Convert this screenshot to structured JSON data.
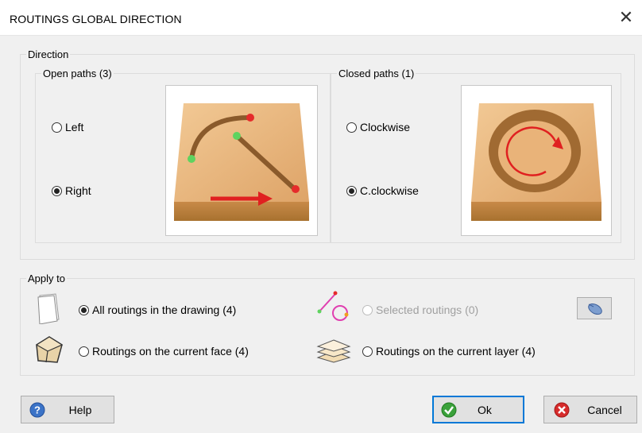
{
  "window": {
    "title": "ROUTINGS GLOBAL DIRECTION",
    "close_glyph": "✕"
  },
  "direction": {
    "legend": "Direction",
    "open_paths": {
      "legend": "Open paths (3)",
      "options": [
        {
          "label": "Left",
          "selected": false
        },
        {
          "label": "Right",
          "selected": true
        }
      ]
    },
    "closed_paths": {
      "legend": "Closed paths (1)",
      "options": [
        {
          "label": "Clockwise",
          "selected": false
        },
        {
          "label": "C.clockwise",
          "selected": true
        }
      ]
    }
  },
  "apply_to": {
    "legend": "Apply to",
    "options": [
      {
        "label": "All routings in the drawing (4)",
        "selected": true,
        "enabled": true,
        "icon": "page-icon"
      },
      {
        "label": "Routings on the current face (4)",
        "selected": false,
        "enabled": true,
        "icon": "cube-face-icon"
      },
      {
        "label": "Selected routings (0)",
        "selected": false,
        "enabled": false,
        "icon": "selected-path-icon"
      },
      {
        "label": "Routings on the current layer (4)",
        "selected": false,
        "enabled": true,
        "icon": "layers-icon"
      }
    ]
  },
  "buttons": {
    "help": "Help",
    "ok": "Ok",
    "cancel": "Cancel"
  },
  "colors": {
    "wood_light": "#e8b27a",
    "wood_dark": "#b8803f",
    "arrow_red": "#e02020",
    "point_green": "#5fd35f",
    "point_red": "#e52b2b",
    "accent_blue": "#0078d7"
  }
}
